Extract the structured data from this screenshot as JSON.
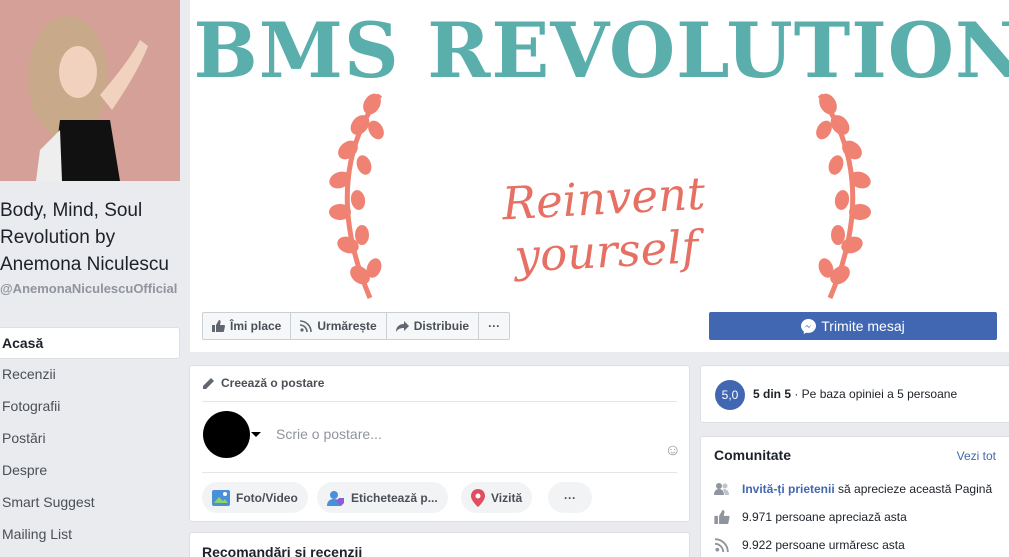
{
  "page": {
    "name": "Body, Mind, Soul Revolution by Anemona Niculescu",
    "handle": "@AnemonaNiculescuOfficial"
  },
  "nav": {
    "items": [
      {
        "label": "Acasă"
      },
      {
        "label": "Recenzii"
      },
      {
        "label": "Fotografii"
      },
      {
        "label": "Postări"
      },
      {
        "label": "Despre"
      },
      {
        "label": "Smart Suggest"
      },
      {
        "label": "Mailing List"
      }
    ]
  },
  "cover": {
    "title": "BMS REVOLUTION",
    "tagline": "Reinvent yourself",
    "colors": {
      "title": "#5aafac",
      "tagline": "#e57063"
    }
  },
  "actions": {
    "like": "Îmi place",
    "follow": "Urmărește",
    "share": "Distribuie",
    "more": "···",
    "message": "Trimite mesaj"
  },
  "composer": {
    "header": "Creează o postare",
    "placeholder": "Scrie o postare...",
    "photo": "Foto/Video",
    "tag": "Etichetează p...",
    "checkin": "Vizită",
    "more": "···"
  },
  "reviews": {
    "title": "Recomandări și recenzii"
  },
  "rating": {
    "score": "5,0",
    "out_of": "5 din 5",
    "basis": " · Pe baza opiniei a 5 persoane"
  },
  "community": {
    "title": "Comunitate",
    "see_all": "Vezi tot",
    "invite_link": "Invită-ți prietenii",
    "invite_rest": " să aprecieze această Pagină",
    "likes": "9.971 persoane apreciază asta",
    "follows": "9.922 persoane urmăresc asta"
  },
  "colors": {
    "accent": "#4267b2"
  }
}
